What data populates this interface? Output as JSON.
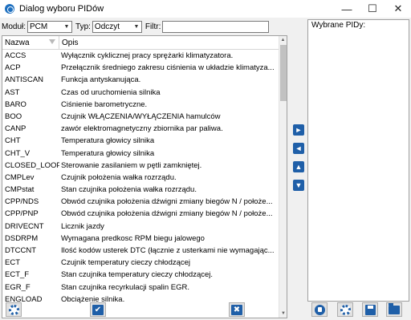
{
  "window": {
    "title": "Dialog wyboru PIDów",
    "minimize": "—",
    "maximize": "☐",
    "close": "✕"
  },
  "toolbar": {
    "module_label": "Moduł:",
    "module_value": "PCM",
    "type_label": "Typ:",
    "type_value": "Odczyt",
    "filter_label": "Filtr:",
    "filter_value": ""
  },
  "table": {
    "col_name": "Nazwa",
    "col_desc": "Opis",
    "rows": [
      [
        "ACCS",
        "Wyłącznik cyklicznej pracy sprężarki klimatyzatora."
      ],
      [
        "ACP",
        "Przełącznik średniego zakresu ciśnienia w układzie klimatyza..."
      ],
      [
        "ANTISCAN",
        "Funkcja antyskanująca."
      ],
      [
        "AST",
        "Czas od uruchomienia silnika"
      ],
      [
        "BARO",
        "Ciśnienie barometryczne."
      ],
      [
        "BOO",
        "Czujnik WŁĄCZENIA/WYŁĄCZENIA hamulców"
      ],
      [
        "CANP",
        "zawór elektromagnetyczny zbiornika par paliwa."
      ],
      [
        "CHT",
        "Temperatura głowicy silnika"
      ],
      [
        "CHT_V",
        "Temperatura głowicy silnika"
      ],
      [
        "CLOSED_LOOP",
        "Sterowanie zasilaniem w pętli zamkniętej."
      ],
      [
        "CMPLev",
        "Czujnik położenia wałka rozrządu."
      ],
      [
        "CMPstat",
        "Stan czujnika położenia wałka rozrządu."
      ],
      [
        "CPP/NDS",
        "Obwód czujnika położenia dźwigni zmiany biegów N / położe..."
      ],
      [
        "CPP/PNP",
        "Obwód czujnika położenia dźwigni zmiany biegów N / położe..."
      ],
      [
        "DRIVECNT",
        "Licznik jazdy"
      ],
      [
        "DSDRPM",
        "Wymagana predkosc RPM biegu jalowego"
      ],
      [
        "DTCCNT",
        "Ilość kodów usterek DTC (łącznie z usterkami nie wymagając..."
      ],
      [
        "ECT",
        "Czujnik temperatury cieczy chłodzącej"
      ],
      [
        "ECT_F",
        "Stan czujnika temperatury cieczy chłodzącej."
      ],
      [
        "EGR_F",
        "Stan czujnika recyrkulacji spalin EGR."
      ],
      [
        "ENGLOAD",
        "Obciążenie silnika."
      ]
    ]
  },
  "selected": {
    "header": "Wybrane PIDy:"
  },
  "middle": {
    "add": "►",
    "remove": "◄",
    "up": "▲",
    "down": "▼"
  },
  "bottom": {
    "ok": "✔",
    "cancel": "✖"
  },
  "colors": {
    "accent": "#1f5fa8"
  }
}
